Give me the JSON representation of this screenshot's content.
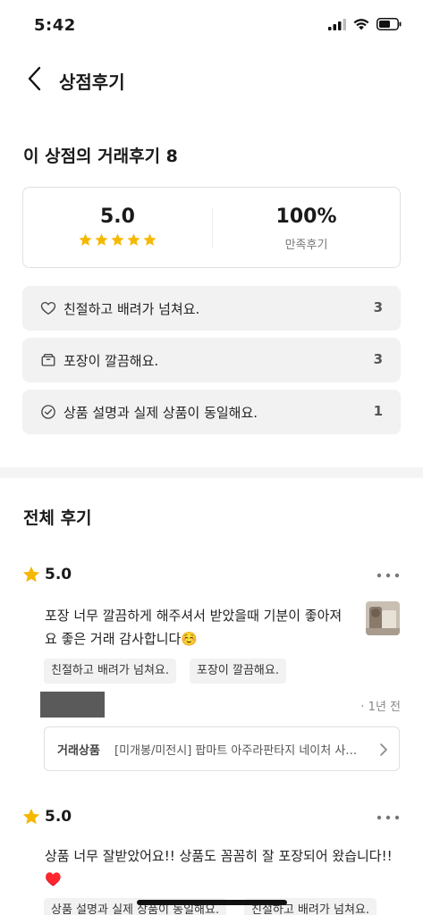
{
  "status_bar": {
    "time": "5:42"
  },
  "header": {
    "title": "상점후기"
  },
  "summary": {
    "title": "이 상점의 거래후기 8",
    "rating": "5.0",
    "star_count": 5,
    "satisfaction": "100%",
    "satisfaction_label": "만족후기"
  },
  "keywords": [
    {
      "icon": "heart-icon",
      "label": "친절하고 배려가 넘쳐요.",
      "count": "3"
    },
    {
      "icon": "box-icon",
      "label": "포장이 깔끔해요.",
      "count": "3"
    },
    {
      "icon": "check-circle-icon",
      "label": "상품 설명과 실제 상품이 동일해요.",
      "count": "1"
    }
  ],
  "reviews_section": {
    "title": "전체 후기"
  },
  "reviews": [
    {
      "rating": "5.0",
      "text": "포장 너무 깔끔하게 해주셔서 받았을때 기분이 좋아져요 좋은 거래 감사합니다☺️",
      "tags": [
        "친절하고 배려가 넘쳐요.",
        "포장이 깔끔해요."
      ],
      "time_ago": "· 1년 전",
      "product_label": "거래상품",
      "product_name": "[미개봉/미전시] 팝마트 아주라판타지 네이처 사…"
    },
    {
      "rating": "5.0",
      "text": "상품 너무 잘받았어요!! 상품도 꼼꼼히 잘 포장되어 왔습니다!! ♥️",
      "tags": [
        "상품 설명과 실제 상품이 동일해요.",
        "친절하고 배려가 넘쳐요."
      ]
    }
  ],
  "colors": {
    "star": "#F5B800",
    "accent_heart": "#E0242F",
    "keyword_bg": "#F2F2F2"
  }
}
